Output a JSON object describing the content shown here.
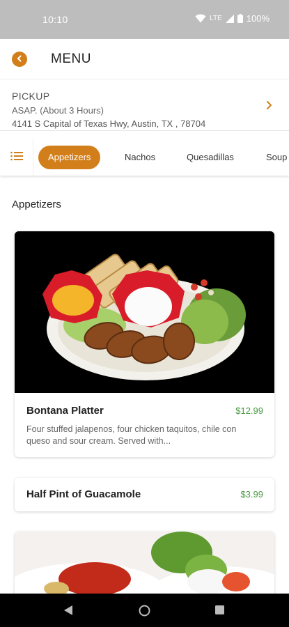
{
  "status_bar": {
    "time": "10:10",
    "network": "LTE",
    "battery": "100%"
  },
  "header": {
    "title": "MENU",
    "accent_color": "#d27f1b"
  },
  "pickup": {
    "mode": "PICKUP",
    "time": "ASAP. (About 3 Hours)",
    "address": "4141 S Capital of Texas Hwy, Austin, TX ,  78704"
  },
  "tabs": [
    {
      "label": "Appetizers",
      "active": true
    },
    {
      "label": "Nachos",
      "active": false
    },
    {
      "label": "Quesadillas",
      "active": false
    },
    {
      "label": "Soup",
      "active": false
    }
  ],
  "section": {
    "title": "Appetizers"
  },
  "items": [
    {
      "name": "Bontana Platter",
      "price": "$12.99",
      "description": "Four stuffed jalapenos, four chicken taquitos, chile con queso and sour cream. Served with..."
    },
    {
      "name": "Half Pint of Guacamole",
      "price": "$3.99"
    }
  ],
  "colors": {
    "price": "#4c9a45",
    "status_bar": "#bdbdbd"
  }
}
